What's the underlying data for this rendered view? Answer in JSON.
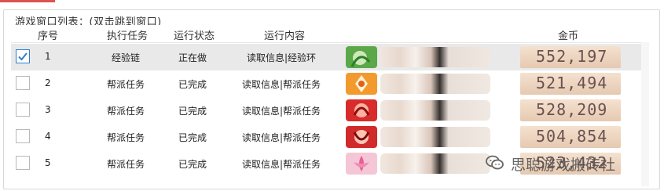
{
  "window": {
    "group_title": "游戏窗口列表：(双击跳到窗口)"
  },
  "table": {
    "headers": [
      "序号",
      "执行任务",
      "运行状态",
      "运行内容",
      "金币"
    ],
    "rows": [
      {
        "index": "1",
        "task": "经验链",
        "status": "正在做",
        "content": "读取信息|经验环",
        "gold": "552,197",
        "checked": true
      },
      {
        "index": "2",
        "task": "帮派任务",
        "status": "已完成",
        "content": "读取信息|帮派任务",
        "gold": "521,494",
        "checked": false
      },
      {
        "index": "3",
        "task": "帮派任务",
        "status": "已完成",
        "content": "读取信息|帮派任务",
        "gold": "528,209",
        "checked": false
      },
      {
        "index": "4",
        "task": "帮派任务",
        "status": "已完成",
        "content": "读取信息|帮派任务",
        "gold": "504,854",
        "checked": false
      },
      {
        "index": "5",
        "task": "帮派任务",
        "status": "已完成",
        "content": "读取信息|帮派任务",
        "gold": "523,432",
        "checked": false
      }
    ]
  },
  "watermark": {
    "text": "思聪游戏搬砖社",
    "icon": "wechat-icon"
  },
  "colors": {
    "accent": "#2f7dd1",
    "selected_row": "#e9e9e9",
    "gold_bg": "#efd6c0",
    "top_tab_line": "#d9534f"
  }
}
